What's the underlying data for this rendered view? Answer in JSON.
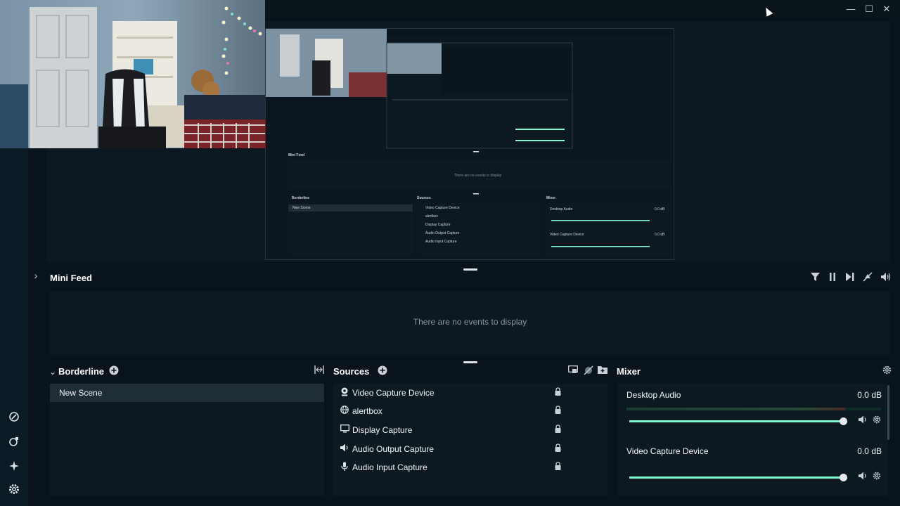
{
  "window": {
    "controls": [
      {
        "name": "minimize",
        "glyph": "—"
      },
      {
        "name": "maximize",
        "glyph": "☐"
      },
      {
        "name": "close",
        "glyph": "✕"
      }
    ]
  },
  "sidebar": {
    "icons": [
      "themes-icon",
      "app-store-icon",
      "highlighter-icon",
      "settings-icon"
    ]
  },
  "mini_feed": {
    "title": "Mini Feed",
    "empty_text": "There are no events to display",
    "tools": [
      "filter-icon",
      "pause-icon",
      "skip-icon",
      "mute-alerts-icon",
      "volume-icon"
    ]
  },
  "scenes": {
    "collection_name": "Borderline",
    "items": [
      {
        "label": "New Scene",
        "selected": true
      }
    ]
  },
  "sources": {
    "title": "Sources",
    "items": [
      {
        "label": "Video Capture Device",
        "icon": "webcam-icon"
      },
      {
        "label": "alertbox",
        "icon": "globe-icon"
      },
      {
        "label": "Display Capture",
        "icon": "monitor-icon"
      },
      {
        "label": "Audio Output Capture",
        "icon": "speaker-icon"
      },
      {
        "label": "Audio Input Capture",
        "icon": "microphone-icon"
      }
    ]
  },
  "mixer": {
    "title": "Mixer",
    "channels": [
      {
        "name": "Desktop Audio",
        "db": "0.0 dB",
        "volume": 1.0,
        "meter": 0.86
      },
      {
        "name": "Video Capture Device",
        "db": "0.0 dB",
        "volume": 1.0,
        "meter": 0
      }
    ]
  },
  "nested_preview": {
    "mini_feed_title": "Mini Feed",
    "empty_text": "There are no events to display",
    "scenes_title": "Borderline",
    "scene": "New Scene",
    "sources_title": "Sources",
    "sources": [
      "Video Capture Device",
      "alertbox",
      "Display Capture",
      "Audio Output Capture",
      "Audio Input Capture"
    ],
    "mixer_title": "Mixer",
    "channels": [
      {
        "name": "Desktop Audio",
        "db": "0.0 dB"
      },
      {
        "name": "Video Capture Device",
        "db": "0.0 dB"
      }
    ]
  },
  "colors": {
    "background": "#09131b",
    "panel": "#0c1921",
    "accent": "#80f5d2",
    "selected_scene": "#1f2d37"
  }
}
